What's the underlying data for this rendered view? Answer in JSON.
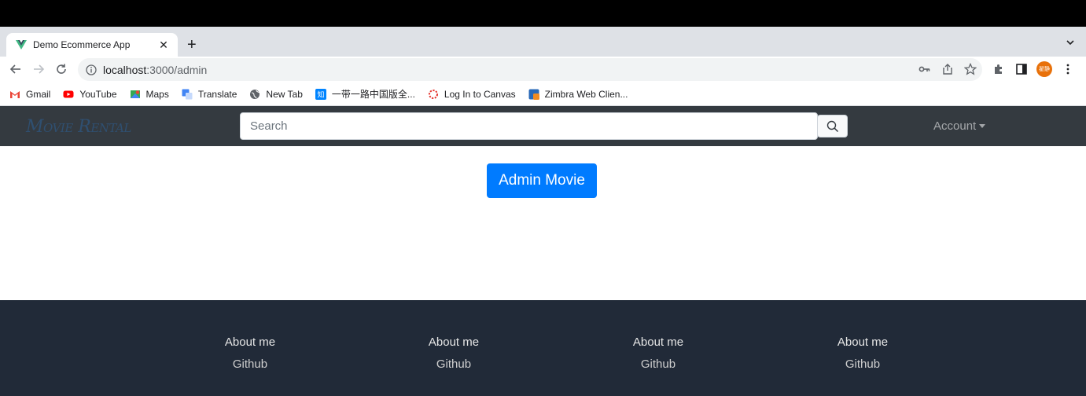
{
  "browser": {
    "tab": {
      "title": "Demo Ecommerce App",
      "close": "✕"
    },
    "new_tab": "+",
    "omnibox": {
      "host": "localhost",
      "path": ":3000/admin"
    },
    "avatar_text": "翟静",
    "bookmarks": [
      {
        "label": "Gmail",
        "icon": "gmail-icon"
      },
      {
        "label": "YouTube",
        "icon": "youtube-icon"
      },
      {
        "label": "Maps",
        "icon": "maps-icon"
      },
      {
        "label": "Translate",
        "icon": "translate-icon"
      },
      {
        "label": "New Tab",
        "icon": "globe-icon"
      },
      {
        "label": "一带一路中国版全...",
        "icon": "zhihu-icon"
      },
      {
        "label": "Log In to Canvas",
        "icon": "canvas-icon"
      },
      {
        "label": "Zimbra Web Clien...",
        "icon": "zimbra-icon"
      }
    ]
  },
  "app": {
    "brand": "Movie Rental",
    "search_placeholder": "Search",
    "account_label": "Account",
    "admin_button": "Admin Movie"
  },
  "footer": {
    "columns": [
      {
        "about": "About me",
        "github": "Github"
      },
      {
        "about": "About me",
        "github": "Github"
      },
      {
        "about": "About me",
        "github": "Github"
      },
      {
        "about": "About me",
        "github": "Github"
      }
    ]
  },
  "colors": {
    "navbar": "#343a40",
    "primary": "#007bff",
    "footer": "#212a38"
  }
}
